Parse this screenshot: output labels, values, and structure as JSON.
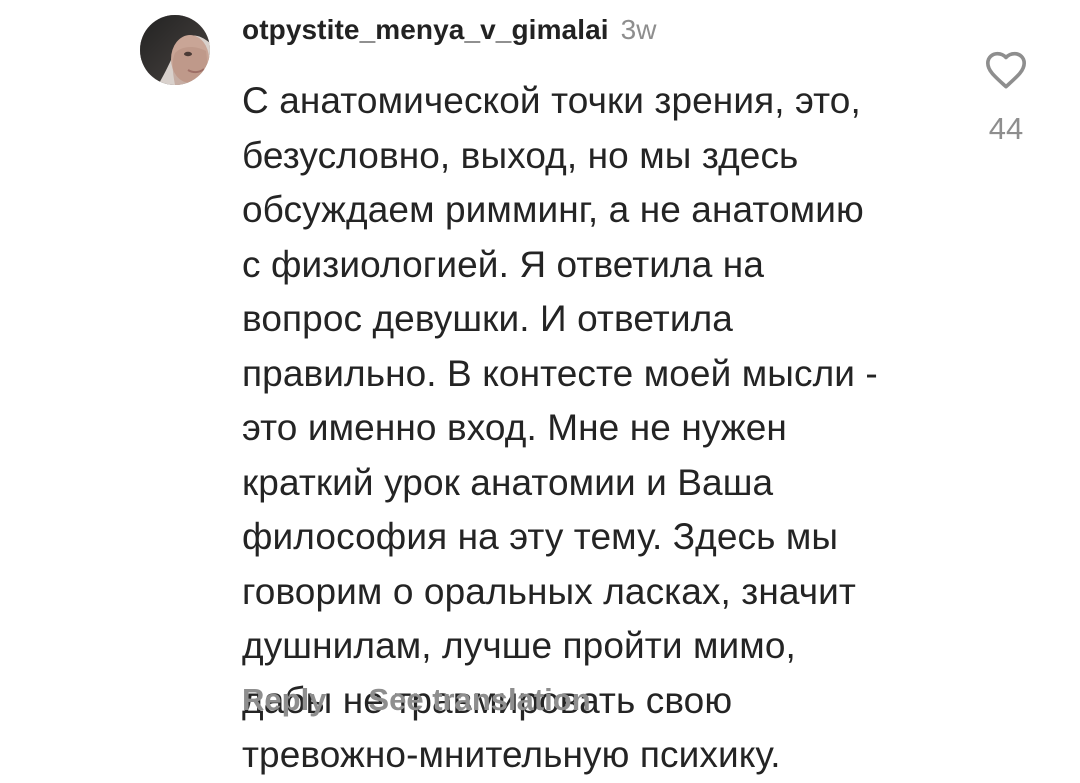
{
  "comment": {
    "username": "otpystite_menya_v_gimalai",
    "time": "3w",
    "text": "С анатомической точки зрения, это,\nбезусловно, выход, но мы здесь\nобсуждаем римминг, а не анатомию\nс физиологией. Я ответила на\nвопрос девушки. И ответила\nправильно. В контесте моей мысли -\nэто именно вход. Мне не нужен\nкраткий урок анатомии и Ваша\nфилософия на эту тему. Здесь мы\nговорим о оральных ласках, значит\nдушнилам, лучше пройти мимо,\nдабы не травмировать свою\nтревожно-мнительную психику.",
    "likes": "44"
  },
  "actions": {
    "reply": "Reply",
    "translate": "See translation"
  },
  "icons": {
    "like": "heart-outline-icon"
  }
}
